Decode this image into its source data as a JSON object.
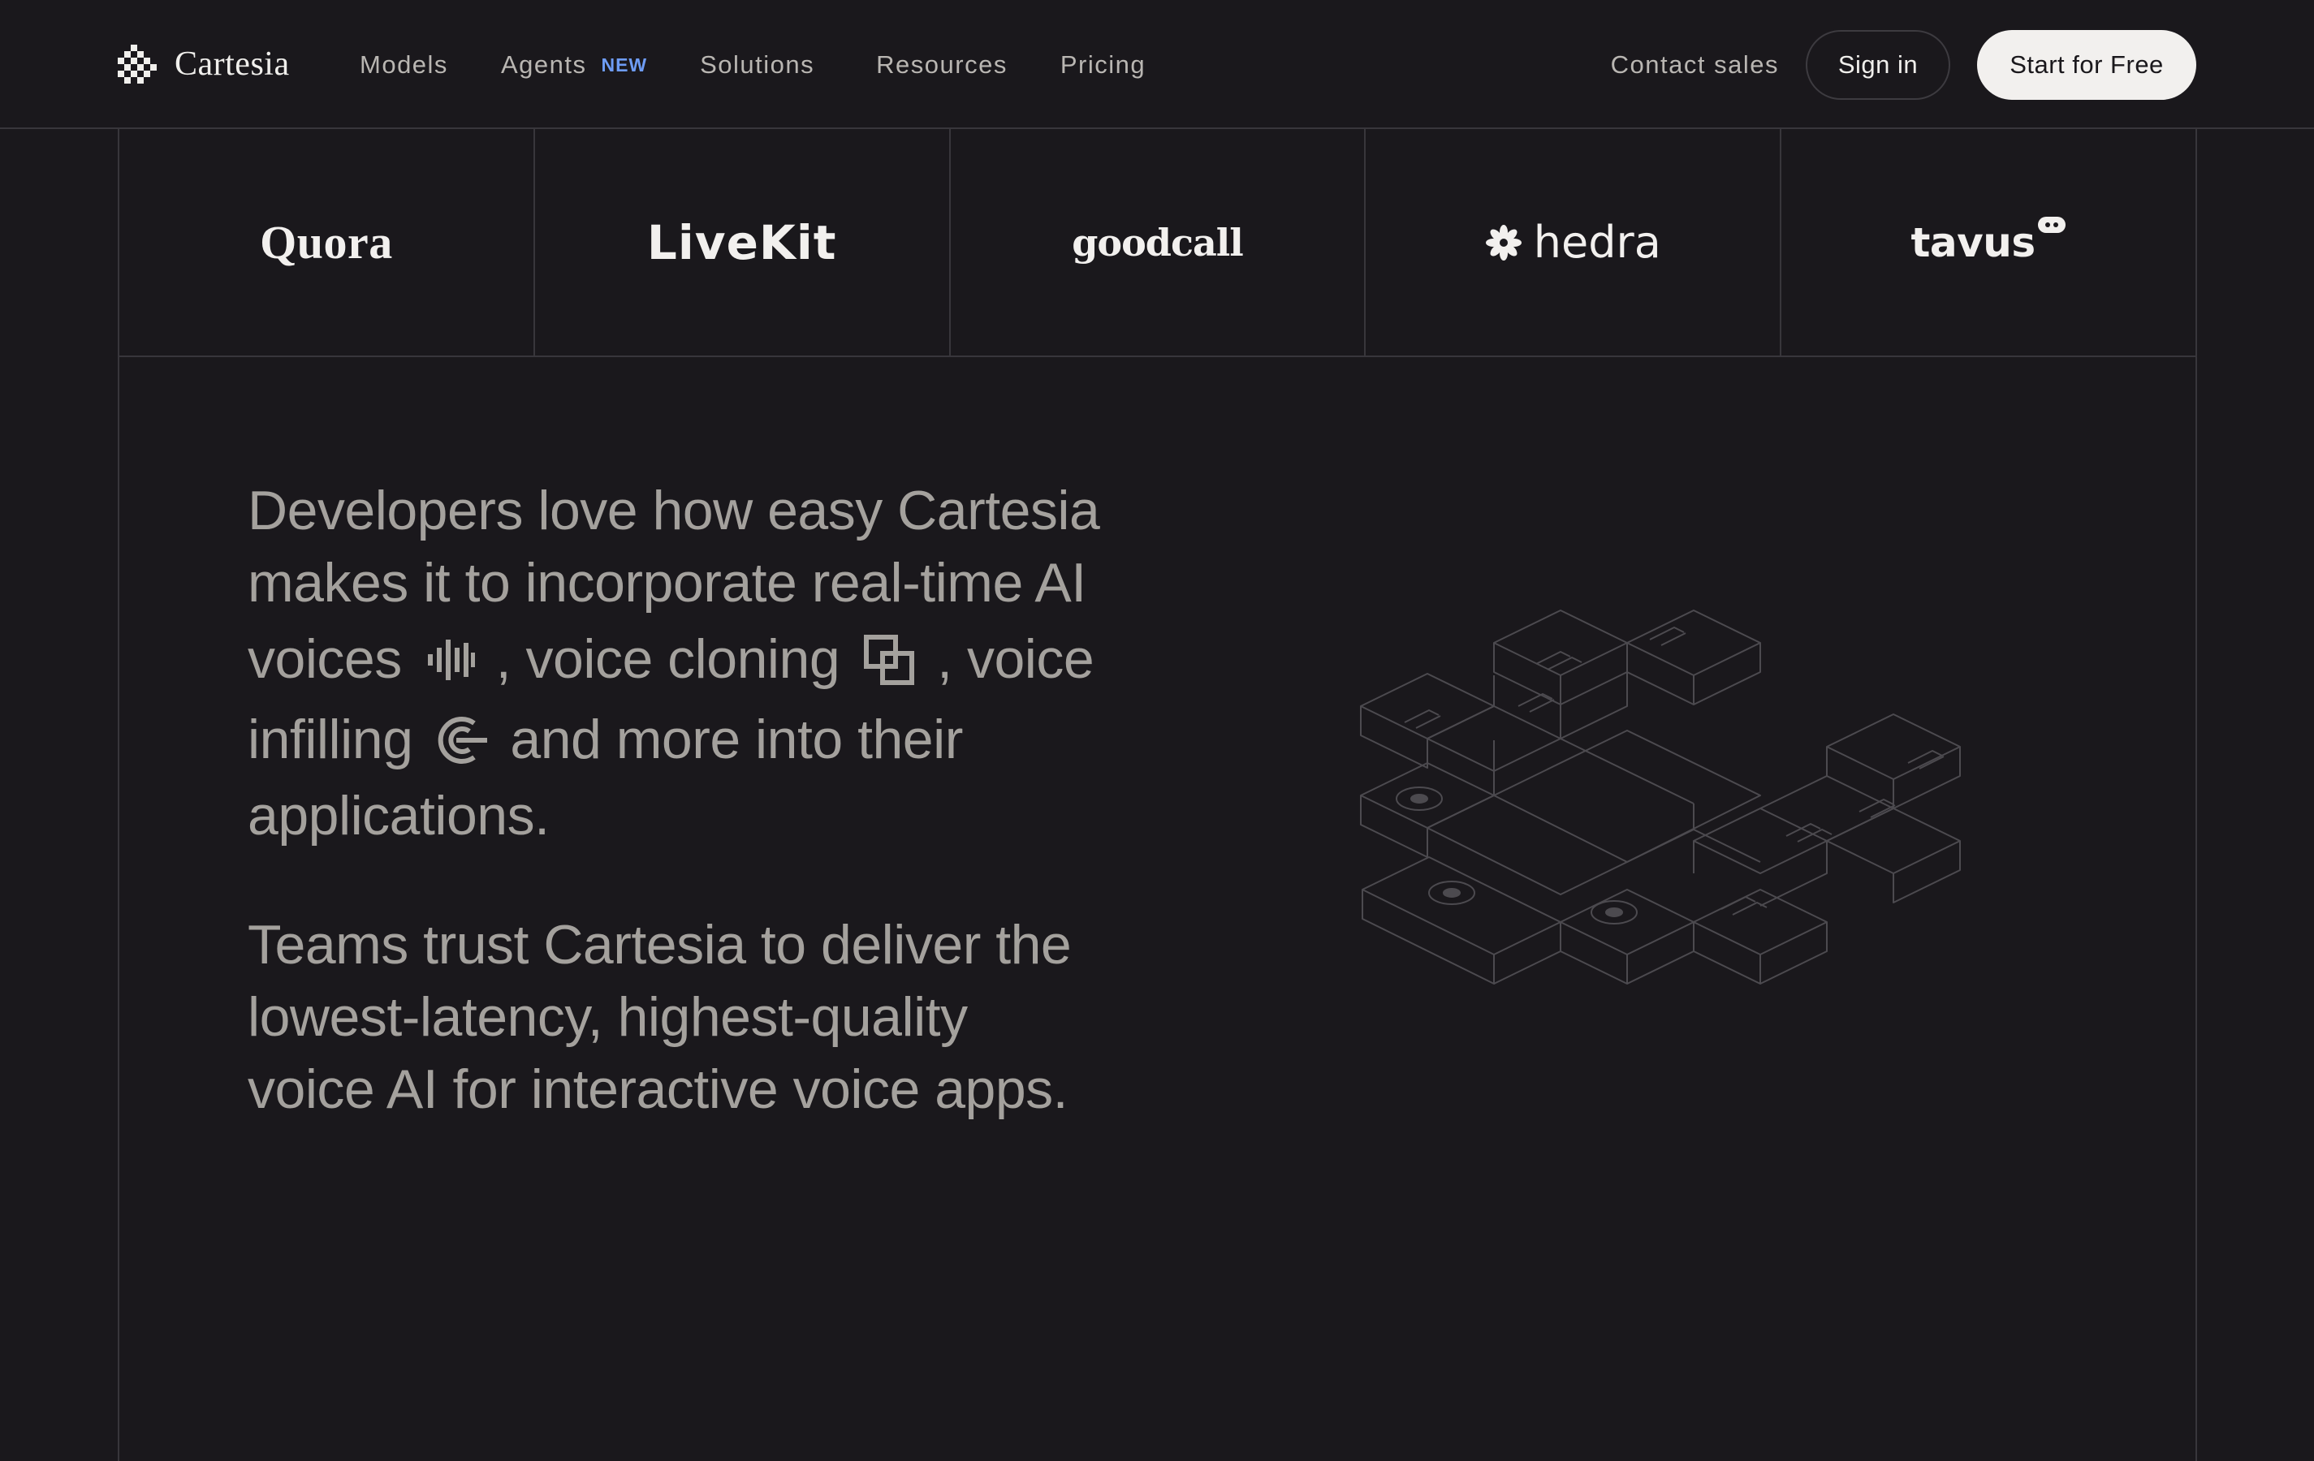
{
  "brand": {
    "name": "Cartesia"
  },
  "nav": {
    "links": [
      {
        "label": "Models"
      },
      {
        "label": "Agents",
        "badge": "NEW"
      },
      {
        "label": "Solutions"
      },
      {
        "label": "Resources"
      },
      {
        "label": "Pricing"
      }
    ],
    "contact_label": "Contact sales",
    "signin_label": "Sign in",
    "start_label": "Start for Free"
  },
  "logos": [
    "Quora",
    "LiveKit",
    "goodcall",
    "hedra",
    "tavus"
  ],
  "copy": {
    "p1_a": "Developers love how easy Cartesia",
    "p1_b": "makes it to incorporate real-time AI",
    "p1_c": "voices",
    "p1_d": ", voice cloning",
    "p1_e": ", voice",
    "p1_f": "infilling",
    "p1_g": "and more into their",
    "p1_h": "applications.",
    "p2_a": "Teams trust Cartesia to deliver the",
    "p2_b": "lowest-latency, highest-quality",
    "p2_c": "voice AI for interactive voice apps."
  },
  "colors": {
    "background": "#1a181c",
    "accent_badge": "#6e9cf5",
    "body_text": "#a4a19d",
    "cta_bg": "#f2f0ee"
  },
  "icons": [
    "waveform-icon",
    "voice-cloning-icon",
    "voice-infilling-icon"
  ]
}
